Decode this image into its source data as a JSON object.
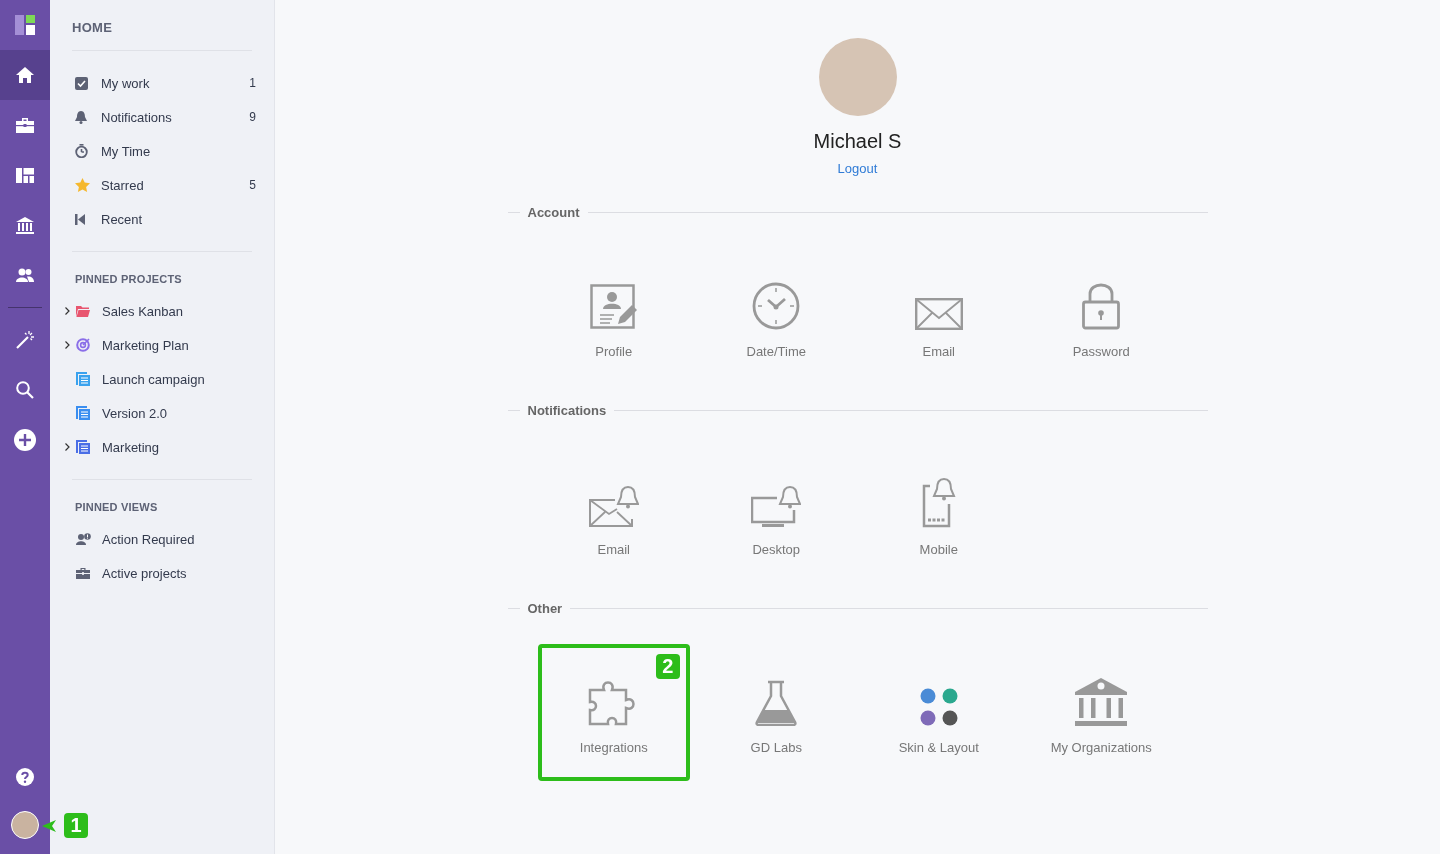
{
  "rail": {
    "top": [
      {
        "kind": "home",
        "selected": true
      },
      {
        "kind": "briefcase",
        "selected": false
      },
      {
        "kind": "board",
        "selected": false
      },
      {
        "kind": "bank",
        "selected": false
      },
      {
        "kind": "people",
        "selected": false
      }
    ],
    "tools": [
      {
        "kind": "wand"
      },
      {
        "kind": "search"
      },
      {
        "kind": "plus"
      }
    ],
    "bottom": [
      {
        "kind": "help"
      },
      {
        "kind": "avatar",
        "callout": "1"
      }
    ]
  },
  "sidebar": {
    "heading": "HOME",
    "items": [
      {
        "kind": "check",
        "label": "My work",
        "count": "1"
      },
      {
        "kind": "bell",
        "label": "Notifications",
        "count": "9"
      },
      {
        "kind": "timer",
        "label": "My Time"
      },
      {
        "kind": "star",
        "label": "Starred",
        "count": "5"
      },
      {
        "kind": "recent",
        "label": "Recent"
      }
    ],
    "pinned_projects": {
      "heading": "PINNED PROJECTS",
      "items": [
        {
          "kind": "folder",
          "label": "Sales Kanban",
          "expandable": true,
          "color": "#e8556f"
        },
        {
          "kind": "target",
          "label": "Marketing Plan",
          "expandable": true,
          "color": "#8a6ee8"
        },
        {
          "kind": "list",
          "label": "Launch campaign",
          "expandable": false,
          "color": "#3aa2ee"
        },
        {
          "kind": "list",
          "label": "Version 2.0",
          "expandable": false,
          "color": "#3a8ef0"
        },
        {
          "kind": "list",
          "label": "Marketing",
          "expandable": true,
          "color": "#4a6ee6"
        }
      ]
    },
    "pinned_views": {
      "heading": "PINNED VIEWS",
      "items": [
        {
          "kind": "person-alert",
          "label": "Action Required"
        },
        {
          "kind": "briefcase",
          "label": "Active projects"
        }
      ]
    }
  },
  "profile": {
    "name": "Michael S",
    "logout": "Logout"
  },
  "sections": [
    {
      "title": "Account",
      "items": [
        {
          "kind": "profile",
          "label": "Profile"
        },
        {
          "kind": "clock",
          "label": "Date/Time"
        },
        {
          "kind": "envelope",
          "label": "Email"
        },
        {
          "kind": "lock",
          "label": "Password"
        }
      ]
    },
    {
      "title": "Notifications",
      "items": [
        {
          "kind": "envelope-bell",
          "label": "Email"
        },
        {
          "kind": "desktop-bell",
          "label": "Desktop"
        },
        {
          "kind": "mobile-bell",
          "label": "Mobile"
        }
      ]
    },
    {
      "title": "Other",
      "items": [
        {
          "kind": "puzzle",
          "label": "Integrations",
          "callout": "2"
        },
        {
          "kind": "flask",
          "label": "GD Labs"
        },
        {
          "kind": "dots",
          "label": "Skin & Layout"
        },
        {
          "kind": "bank",
          "label": "My Organizations"
        }
      ]
    }
  ]
}
